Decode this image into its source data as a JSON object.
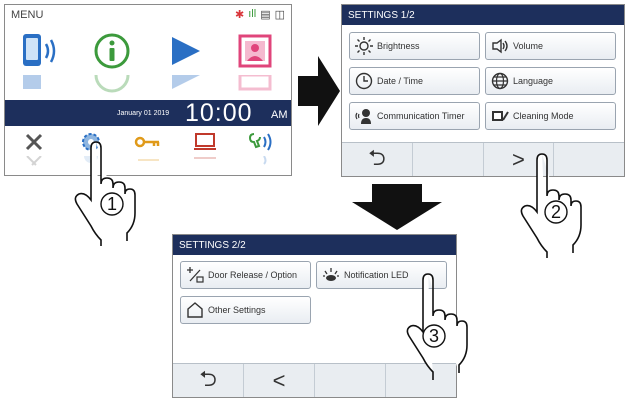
{
  "menu": {
    "title": "MENU",
    "date": "January 01 2019",
    "time": "10:00",
    "ampm": "AM"
  },
  "settings1": {
    "title": "SETTINGS 1/2",
    "buttons": [
      {
        "label": "Brightness",
        "icon": "brightness-icon"
      },
      {
        "label": "Volume",
        "icon": "volume-icon"
      },
      {
        "label": "Date / Time",
        "icon": "clock-icon"
      },
      {
        "label": "Language",
        "icon": "globe-icon"
      },
      {
        "label": "Communication Timer",
        "icon": "communication-timer-icon"
      },
      {
        "label": "Cleaning Mode",
        "icon": "cleaning-mode-icon"
      }
    ],
    "nav": {
      "back": "⮌",
      "next": ">"
    }
  },
  "settings2": {
    "title": "SETTINGS 2/2",
    "buttons": [
      {
        "label": "Door Release / Option",
        "icon": "door-release-icon"
      },
      {
        "label": "Notification LED",
        "icon": "notification-led-icon"
      },
      {
        "label": "Other Settings",
        "icon": "home-icon"
      }
    ],
    "nav": {
      "back": "⮌",
      "prev": "<"
    }
  },
  "steps": [
    "1",
    "2",
    "3"
  ],
  "colors": {
    "title_bar": "#1d2f5c",
    "accent_blue": "#2a6fc4",
    "accent_green": "#3c9a3c",
    "accent_pink": "#e0457b",
    "accent_orange": "#e09a1a",
    "alert_red": "#d9363b"
  }
}
